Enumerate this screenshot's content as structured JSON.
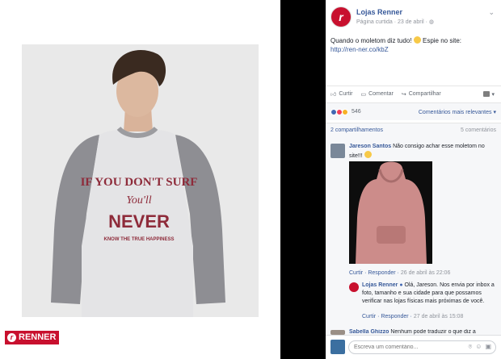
{
  "brand": {
    "logo_text": "RENNER",
    "accent_color": "#c8102e"
  },
  "photo": {
    "sweatshirt_text": [
      "IF YOU DON'T SURF",
      "You'll",
      "NEVER",
      "KNOW THE TRUE HAPPINESS"
    ]
  },
  "post": {
    "page_name": "Lojas Renner",
    "meta": "Página curtida · 23 de abril ·",
    "text": "Quando o moletom diz tudo!",
    "text_suffix": " Espie no site:",
    "link": "http://ren-ner.co/kbZ",
    "actions": {
      "like": "Curtir",
      "comment": "Comentar",
      "share": "Compartilhar"
    },
    "reaction_count": "546",
    "comment_order": "Comentários mais relevantes",
    "shares": "2 compartilhamentos",
    "comments_count": "5 comentários"
  },
  "comments": [
    {
      "name": "Jareson Santos",
      "text": "Não consigo achar esse moletom no site!!!",
      "like": "Curtir",
      "reply": "Responder",
      "time": "26 de abril às 22:06"
    },
    {
      "name": "Lojas Renner",
      "text": "Olá, Jareson. Nos envia por inbox a foto, tamanho e sua cidade para que possamos verificar nas lojas físicas mais próximas de você.",
      "like": "Curtir",
      "reply": "Responder",
      "time": "27 de abril às 15:08"
    },
    {
      "name": "Sabella Ghizzo",
      "text": "Nenhum pode traduzir o que diz a"
    }
  ],
  "composer": {
    "placeholder": "Escreva um comentário..."
  }
}
